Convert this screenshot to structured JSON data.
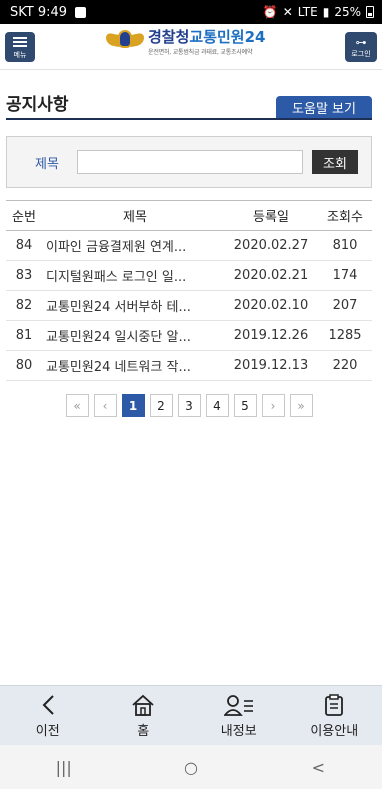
{
  "status_bar": {
    "carrier_time": "SKT 9:49",
    "network": "LTE",
    "battery": "25%"
  },
  "header": {
    "menu_label": "메뉴",
    "login_label": "로그인",
    "logo_main_prefix": "경찰청",
    "logo_main_accent": "교통민원24",
    "logo_sub": "운전면허, 교통범칙금 과태료, 교통조사예약"
  },
  "page": {
    "title": "공지사항",
    "help_button": "도움말 보기"
  },
  "search": {
    "label": "제목",
    "value": "",
    "placeholder": "",
    "button": "조회"
  },
  "table": {
    "headers": [
      "순번",
      "제목",
      "등록일",
      "조회수"
    ],
    "rows": [
      {
        "no": "84",
        "title": "이파인 금융결제원 연계...",
        "date": "2020.02.27",
        "views": "810"
      },
      {
        "no": "83",
        "title": "디지털원패스 로그인 일...",
        "date": "2020.02.21",
        "views": "174"
      },
      {
        "no": "82",
        "title": "교통민원24 서버부하 테...",
        "date": "2020.02.10",
        "views": "207"
      },
      {
        "no": "81",
        "title": "교통민원24 일시중단 알...",
        "date": "2019.12.26",
        "views": "1285"
      },
      {
        "no": "80",
        "title": "교통민원24 네트워크 작...",
        "date": "2019.12.13",
        "views": "220"
      }
    ]
  },
  "pagination": {
    "first": "«",
    "prev": "‹",
    "pages": [
      "1",
      "2",
      "3",
      "4",
      "5"
    ],
    "current": "1",
    "next": "›",
    "last": "»"
  },
  "bottom_nav": {
    "items": [
      {
        "label": "이전",
        "icon": "back-arrow-icon"
      },
      {
        "label": "홈",
        "icon": "home-icon"
      },
      {
        "label": "내정보",
        "icon": "user-info-icon"
      },
      {
        "label": "이용안내",
        "icon": "guide-clipboard-icon"
      }
    ]
  },
  "system_nav": {
    "recent": "|||",
    "home": "○",
    "back": "<"
  },
  "colors": {
    "primary": "#2d5aa6",
    "header_button": "#2f4a6e",
    "title_line": "#1e2f55",
    "bottom_nav_bg": "#e5eaf0"
  }
}
